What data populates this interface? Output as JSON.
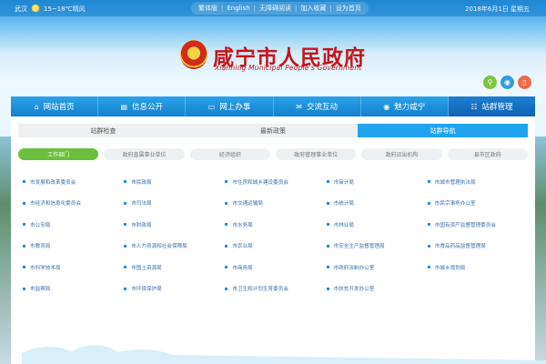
{
  "weather": {
    "city": "武汉",
    "text": "15~18℃晴风"
  },
  "toplinks": [
    "繁体版",
    "English",
    "无障碍阅读",
    "加入收藏",
    "设为首页"
  ],
  "date": "2018年6月1日 星期五",
  "site": {
    "title": "咸宁市人民政府",
    "subtitle": "Xianning Municipal People's Government"
  },
  "social": [
    {
      "icon": "search-icon"
    },
    {
      "icon": "weibo-icon"
    },
    {
      "icon": "mobile-icon"
    }
  ],
  "nav": [
    {
      "label": "网站首页",
      "icon": "home-icon"
    },
    {
      "label": "信息公开",
      "icon": "document-icon"
    },
    {
      "label": "网上办事",
      "icon": "monitor-icon"
    },
    {
      "label": "交流互动",
      "icon": "chat-icon"
    },
    {
      "label": "魅力咸宁",
      "icon": "camera-icon"
    },
    {
      "label": "站群管理",
      "icon": "sitemap-icon"
    }
  ],
  "tabs": [
    "站群检查",
    "最新政策",
    "站群导航"
  ],
  "subtabs": [
    "工作部门",
    "政府直属事业单位",
    "经济组织",
    "政府管理事业单位",
    "政府派出机构",
    "县市区政府"
  ],
  "departments": [
    [
      "市发展和改革委员会",
      "市民政局",
      "市住房和城乡建设委员会",
      "市审计局",
      "市城市管理执法局"
    ],
    [
      "市经济和信息化委员会",
      "市司法局",
      "市交通运输局",
      "市统计局",
      "市民宗事务办公室"
    ],
    [
      "市公安局",
      "市财政局",
      "市水务局",
      "市林业局",
      "市国有资产监督管理委员会"
    ],
    [
      "市教育局",
      "市人力资源和社会保障局",
      "市农业局",
      "市安全生产监督管理局",
      "市食品药品监督管理局"
    ],
    [
      "市科学技术局",
      "市国土资源局",
      "市商务局",
      "市政府法制办公室",
      "市城乡规划局"
    ],
    [
      "市监察局",
      "市环境保护局",
      "市卫生和计划生育委员会",
      "市扶贫开发办公室",
      ""
    ]
  ],
  "colors": {
    "nav": "#1a8bd6",
    "active_tab": "#21a4ee",
    "active_subtab": "#6abf3c",
    "title": "#c4161c"
  }
}
